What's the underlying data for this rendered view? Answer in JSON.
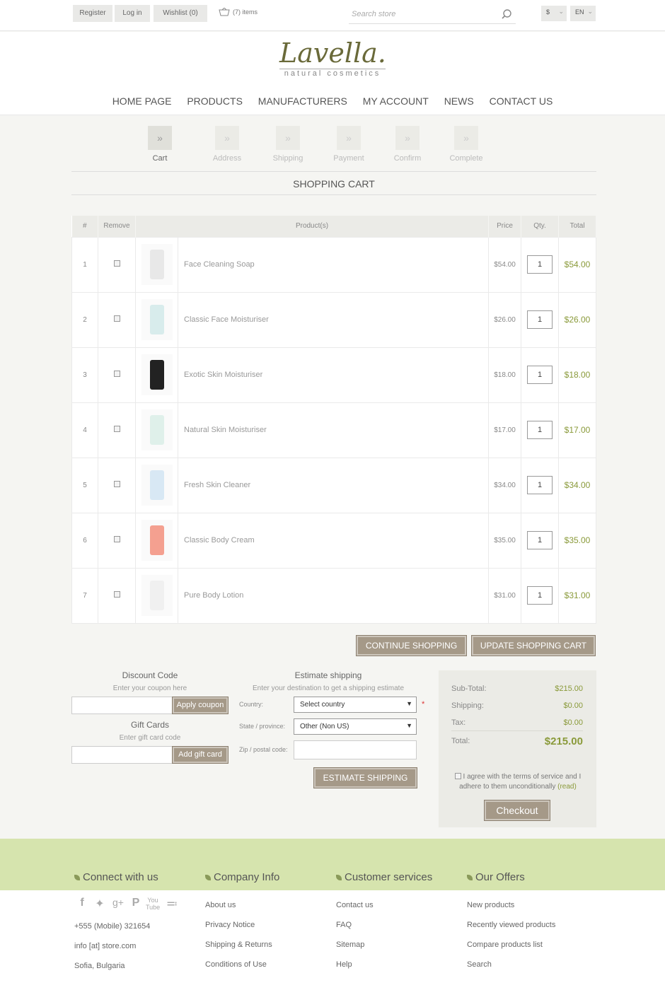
{
  "topbar": {
    "register": "Register",
    "login": "Log in",
    "wishlist": "Wishlist",
    "wishlist_count": "(0)",
    "cart_items": "(7) items",
    "search_placeholder": "Search store",
    "currency": "$",
    "language": "EN"
  },
  "logo": {
    "name": "Lavella.",
    "tagline": "natural cosmetics"
  },
  "nav": [
    "HOME PAGE",
    "PRODUCTS",
    "MANUFACTURERS",
    "MY ACCOUNT",
    "NEWS",
    "CONTACT US"
  ],
  "steps": [
    "Cart",
    "Address",
    "Shipping",
    "Payment",
    "Confirm",
    "Complete"
  ],
  "page_title": "SHOPPING CART",
  "table": {
    "headers": {
      "num": "#",
      "remove": "Remove",
      "product": "Product(s)",
      "price": "Price",
      "qty": "Qty.",
      "total": "Total"
    },
    "rows": [
      {
        "num": "1",
        "name": "Face Cleaning Soap",
        "price": "$54.00",
        "qty": "1",
        "total": "$54.00"
      },
      {
        "num": "2",
        "name": "Classic Face Moisturiser",
        "price": "$26.00",
        "qty": "1",
        "total": "$26.00"
      },
      {
        "num": "3",
        "name": "Exotic Skin Moisturiser",
        "price": "$18.00",
        "qty": "1",
        "total": "$18.00"
      },
      {
        "num": "4",
        "name": "Natural Skin Moisturiser",
        "price": "$17.00",
        "qty": "1",
        "total": "$17.00"
      },
      {
        "num": "5",
        "name": "Fresh Skin Cleaner",
        "price": "$34.00",
        "qty": "1",
        "total": "$34.00"
      },
      {
        "num": "6",
        "name": "Classic Body Cream",
        "price": "$35.00",
        "qty": "1",
        "total": "$35.00"
      },
      {
        "num": "7",
        "name": "Pure Body Lotion",
        "price": "$31.00",
        "qty": "1",
        "total": "$31.00"
      }
    ]
  },
  "buttons": {
    "continue": "CONTINUE SHOPPING",
    "update": "UPDATE SHOPPING CART",
    "apply_coupon": "Apply coupon",
    "add_gift": "Add gift card",
    "estimate": "ESTIMATE SHIPPING",
    "checkout": "Checkout"
  },
  "discount": {
    "title": "Discount Code",
    "sub": "Enter your coupon here"
  },
  "gift": {
    "title": "Gift Cards",
    "sub": "Enter gift card code"
  },
  "estimate": {
    "title": "Estimate shipping",
    "sub": "Enter your destination to get a shipping estimate",
    "country_label": "Country:",
    "country_value": "Select country",
    "state_label": "State / province:",
    "state_value": "Other (Non US)",
    "zip_label": "Zip / postal code:",
    "required": "*"
  },
  "totals": {
    "subtotal_label": "Sub-Total:",
    "subtotal": "$215.00",
    "shipping_label": "Shipping:",
    "shipping": "$0.00",
    "tax_label": "Tax:",
    "tax": "$0.00",
    "total_label": "Total:",
    "total": "$215.00",
    "terms": "I agree with the terms of service and I adhere to them unconditionally",
    "terms_link": "(read)"
  },
  "footer": {
    "col1": {
      "title": "Connect with us",
      "lines": [
        "+555 (Mobile) 321654",
        "info [at] store.com",
        "Sofia, Bulgaria"
      ]
    },
    "col2": {
      "title": "Company Info",
      "links": [
        "About us",
        "Privacy Notice",
        "Shipping & Returns",
        "Conditions of Use"
      ]
    },
    "col3": {
      "title": "Customer services",
      "links": [
        "Contact us",
        "FAQ",
        "Sitemap",
        "Help"
      ]
    },
    "col4": {
      "title": "Our Offers",
      "links": [
        "New products",
        "Recently viewed products",
        "Compare products list",
        "Search"
      ]
    },
    "social": [
      "facebook-icon",
      "twitter-icon",
      "google-plus-icon",
      "pinterest-icon",
      "youtube-icon",
      "rss-icon"
    ]
  },
  "colors": {
    "accent": "#8a9a3a",
    "button": "#a59988",
    "footer_band": "#d6e4ae"
  }
}
